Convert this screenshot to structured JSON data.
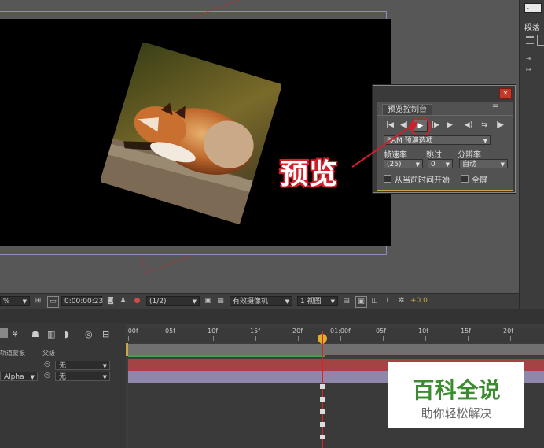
{
  "preview_panel": {
    "tab_label": "预览控制台",
    "options_label": "RAM 预演选项",
    "frame_rate_label": "帧速率",
    "skip_label": "跳过",
    "resolution_label": "分辨率",
    "frame_rate_value": "(25)",
    "skip_value": "0",
    "resolution_value": "自动",
    "from_current_time_label": "从当前时间开始",
    "full_screen_label": "全屏",
    "controls": [
      "|◀",
      "◀|",
      "▶",
      "|▶",
      "▶|",
      "◀)",
      "⇆",
      "|▶"
    ]
  },
  "callout_label": "预览",
  "right_panel": {
    "tab_label": "段落",
    "top_input": "-"
  },
  "viewer_toolbar": {
    "zoom_value": "%",
    "timecode": "0:00:00:23",
    "resolution": "(1/2)",
    "camera": "有效摄像机",
    "views": "1 视图",
    "exposure": "+0.0"
  },
  "timeline": {
    "ruler_labels": [
      ":00f",
      "05f",
      "10f",
      "15f",
      "20f",
      "01:00f",
      "05f",
      "10f",
      "15f",
      "20f"
    ],
    "column_modes": "轨道蒙板",
    "column_parent": "父级",
    "layers": [
      {
        "mode": "",
        "parent": "无"
      },
      {
        "mode": "Alpha",
        "parent": "无"
      }
    ]
  },
  "watermark": {
    "title": "百科全说",
    "subtitle": "助你轻松解决"
  },
  "colors": {
    "accent_red": "#d1202a",
    "panel_border": "#c9a64a",
    "layer1": "#a34343",
    "layer2": "#8e86ab",
    "watermark_green": "#3a8c2f"
  }
}
